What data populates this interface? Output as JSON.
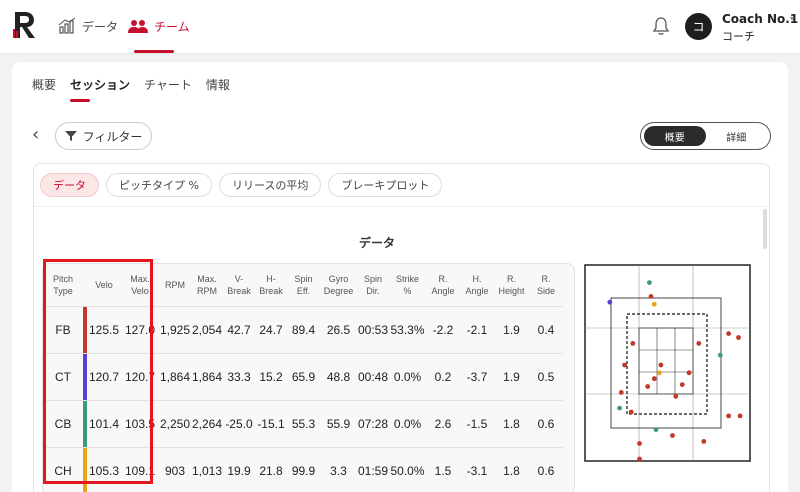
{
  "topnav": {
    "nav_data": "データ",
    "nav_team": "チーム",
    "user_name": "Coach No.1",
    "user_role": "コーチ",
    "avatar_initial": "コ"
  },
  "tabs": [
    "概要",
    "セッション",
    "チャート",
    "情報"
  ],
  "active_tab": "セッション",
  "filter_label": "フィルター",
  "view_toggle": {
    "summary": "概要",
    "detail": "詳細",
    "active": "概要"
  },
  "chips": [
    "データ",
    "ピッチタイプ %",
    "リリースの平均",
    "ブレーキプロット"
  ],
  "active_chip": "データ",
  "section_title": "データ",
  "table": {
    "headers": [
      [
        "Pitch",
        "Type"
      ],
      [
        "Velo"
      ],
      [
        "Max.",
        "Velo"
      ],
      [
        "RPM"
      ],
      [
        "Max.",
        "RPM"
      ],
      [
        "V-",
        "Break"
      ],
      [
        "H-",
        "Break"
      ],
      [
        "Spin",
        "Eff."
      ],
      [
        "Gyro",
        "Degree"
      ],
      [
        "Spin",
        "Dir."
      ],
      [
        "Strike",
        "%"
      ],
      [
        "R.",
        "Angle"
      ],
      [
        "H.",
        "Angle"
      ],
      [
        "R.",
        "Height"
      ],
      [
        "R.",
        "Side"
      ]
    ],
    "rows": [
      {
        "color": "#c0392b",
        "cells": [
          "FB",
          "125.5",
          "127.0",
          "1,925",
          "2,054",
          "42.7",
          "24.7",
          "89.4",
          "26.5",
          "00:53",
          "53.3%",
          "-2.2",
          "-2.1",
          "1.9",
          "0.4"
        ]
      },
      {
        "color": "#5b3fd6",
        "cells": [
          "CT",
          "120.7",
          "120.7",
          "1,864",
          "1,864",
          "33.3",
          "15.2",
          "65.9",
          "48.8",
          "00:48",
          "0.0%",
          "0.2",
          "-3.7",
          "1.9",
          "0.5"
        ]
      },
      {
        "color": "#3a9a7a",
        "cells": [
          "CB",
          "101.4",
          "103.5",
          "2,250",
          "2,264",
          "-25.0",
          "-15.1",
          "55.3",
          "55.9",
          "07:28",
          "0.0%",
          "2.6",
          "-1.5",
          "1.8",
          "0.6"
        ]
      },
      {
        "color": "#e8a317",
        "cells": [
          "CH",
          "105.3",
          "109.1",
          "903",
          "1,013",
          "19.9",
          "21.8",
          "99.9",
          "3.3",
          "01:59",
          "50.0%",
          "1.5",
          "-3.1",
          "1.8",
          "0.6"
        ]
      }
    ]
  },
  "colors": {
    "accent": "#c8102e",
    "highlight": "#e3181f"
  },
  "pitch_plot": {
    "points": [
      {
        "type": "CB",
        "x": 0.39,
        "y": 0.09
      },
      {
        "type": "FB",
        "x": 0.4,
        "y": 0.16
      },
      {
        "type": "CT",
        "x": 0.15,
        "y": 0.19
      },
      {
        "type": "CH",
        "x": 0.42,
        "y": 0.2
      },
      {
        "type": "FB",
        "x": 0.87,
        "y": 0.35
      },
      {
        "type": "FB",
        "x": 0.93,
        "y": 0.37
      },
      {
        "type": "FB",
        "x": 0.29,
        "y": 0.4
      },
      {
        "type": "FB",
        "x": 0.69,
        "y": 0.4
      },
      {
        "type": "CB",
        "x": 0.82,
        "y": 0.46
      },
      {
        "type": "FB",
        "x": 0.24,
        "y": 0.51
      },
      {
        "type": "FB",
        "x": 0.46,
        "y": 0.51
      },
      {
        "type": "FB",
        "x": 0.63,
        "y": 0.55
      },
      {
        "type": "CH",
        "x": 0.45,
        "y": 0.55
      },
      {
        "type": "FB",
        "x": 0.42,
        "y": 0.58
      },
      {
        "type": "FB",
        "x": 0.38,
        "y": 0.62
      },
      {
        "type": "FB",
        "x": 0.59,
        "y": 0.61
      },
      {
        "type": "FB",
        "x": 0.22,
        "y": 0.65
      },
      {
        "type": "FB",
        "x": 0.55,
        "y": 0.67
      },
      {
        "type": "CB",
        "x": 0.21,
        "y": 0.73
      },
      {
        "type": "FB",
        "x": 0.28,
        "y": 0.75
      },
      {
        "type": "FB",
        "x": 0.87,
        "y": 0.77
      },
      {
        "type": "FB",
        "x": 0.94,
        "y": 0.77
      },
      {
        "type": "CB",
        "x": 0.43,
        "y": 0.84
      },
      {
        "type": "FB",
        "x": 0.53,
        "y": 0.87
      },
      {
        "type": "FB",
        "x": 0.72,
        "y": 0.9
      },
      {
        "type": "FB",
        "x": 0.33,
        "y": 0.91
      },
      {
        "type": "FB",
        "x": 0.33,
        "y": 0.99
      }
    ]
  }
}
